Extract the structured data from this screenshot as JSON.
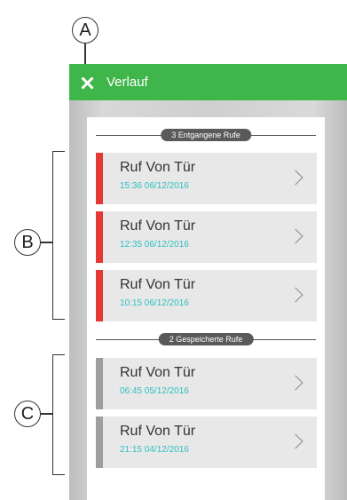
{
  "callouts": {
    "a": "A",
    "b": "B",
    "c": "C"
  },
  "appbar": {
    "title": "Verlauf",
    "close_icon": "close-icon",
    "color": "#3fb64a"
  },
  "missed": {
    "header": "3 Entgangene Rufe",
    "stripe_color": "#e53935",
    "items": [
      {
        "title": "Ruf Von Tür",
        "time": "15:36 06/12/2016"
      },
      {
        "title": "Ruf Von Tür",
        "time": "12:35 06/12/2016"
      },
      {
        "title": "Ruf Von Tür",
        "time": "10:15 06/12/2016"
      }
    ]
  },
  "saved": {
    "header": "2 Gespeicherte Rufe",
    "stripe_color": "#9e9e9e",
    "items": [
      {
        "title": "Ruf Von Tür",
        "time": "06:45 05/12/2016"
      },
      {
        "title": "Ruf Von Tür",
        "time": "21:15 04/12/2016"
      }
    ]
  },
  "colors": {
    "timestamp": "#2fbfc0"
  }
}
